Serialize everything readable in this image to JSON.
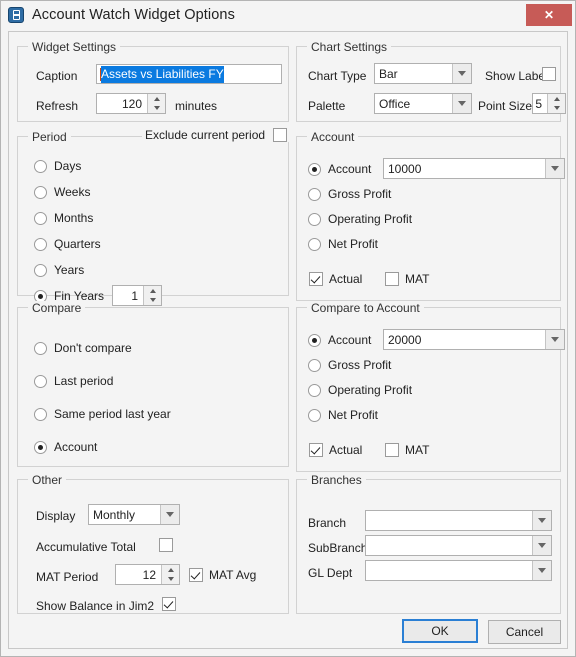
{
  "window": {
    "title": "Account Watch Widget Options",
    "app_icon": "book-icon",
    "close_label": "✕"
  },
  "widget_settings": {
    "legend": "Widget Settings",
    "caption_label": "Caption",
    "caption_value": "Assets vs Liabilities FY",
    "refresh_label": "Refresh",
    "refresh_value": "120",
    "refresh_units": "minutes"
  },
  "chart_settings": {
    "legend": "Chart Settings",
    "chart_type_label": "Chart Type",
    "chart_type_value": "Bar",
    "show_labels_label": "Show Labels",
    "show_labels_checked": false,
    "palette_label": "Palette",
    "palette_value": "Office",
    "point_size_label": "Point Size",
    "point_size_value": "5"
  },
  "period": {
    "legend": "Period",
    "exclude_label": "Exclude current period",
    "exclude_checked": false,
    "options": [
      {
        "label": "Days",
        "selected": false
      },
      {
        "label": "Weeks",
        "selected": false
      },
      {
        "label": "Months",
        "selected": false
      },
      {
        "label": "Quarters",
        "selected": false
      },
      {
        "label": "Years",
        "selected": false
      },
      {
        "label": "Fin Years",
        "selected": true
      }
    ],
    "fin_years_value": "1"
  },
  "account": {
    "legend": "Account",
    "options": [
      {
        "label": "Account",
        "selected": true
      },
      {
        "label": "Gross Profit",
        "selected": false
      },
      {
        "label": "Operating Profit",
        "selected": false
      },
      {
        "label": "Net Profit",
        "selected": false
      }
    ],
    "account_value": "10000",
    "actual_label": "Actual",
    "actual_checked": true,
    "mat_label": "MAT",
    "mat_checked": false
  },
  "compare": {
    "legend": "Compare",
    "options": [
      {
        "label": "Don't compare",
        "selected": false
      },
      {
        "label": "Last period",
        "selected": false
      },
      {
        "label": "Same period last year",
        "selected": false
      },
      {
        "label": "Account",
        "selected": true
      }
    ]
  },
  "compare_to_account": {
    "legend": "Compare to Account",
    "options": [
      {
        "label": "Account",
        "selected": true
      },
      {
        "label": "Gross Profit",
        "selected": false
      },
      {
        "label": "Operating Profit",
        "selected": false
      },
      {
        "label": "Net Profit",
        "selected": false
      }
    ],
    "account_value": "20000",
    "actual_label": "Actual",
    "actual_checked": true,
    "mat_label": "MAT",
    "mat_checked": false
  },
  "other": {
    "legend": "Other",
    "display_label": "Display",
    "display_value": "Monthly",
    "accumulative_label": "Accumulative Total",
    "accumulative_checked": false,
    "mat_period_label": "MAT Period",
    "mat_period_value": "12",
    "mat_avg_label": "MAT Avg",
    "mat_avg_checked": true,
    "show_balance_label": "Show Balance in Jim2",
    "show_balance_checked": true
  },
  "branches": {
    "legend": "Branches",
    "branch_label": "Branch",
    "branch_value": "",
    "subbranch_label": "SubBranch",
    "subbranch_value": "",
    "gl_dept_label": "GL Dept",
    "gl_dept_value": ""
  },
  "footer": {
    "ok_label": "OK",
    "cancel_label": "Cancel"
  },
  "colors": {
    "accent": "#2a7fd4",
    "close": "#c75b57",
    "selection": "#0a7ae0",
    "dialog_bg": "#f4f4f4"
  }
}
